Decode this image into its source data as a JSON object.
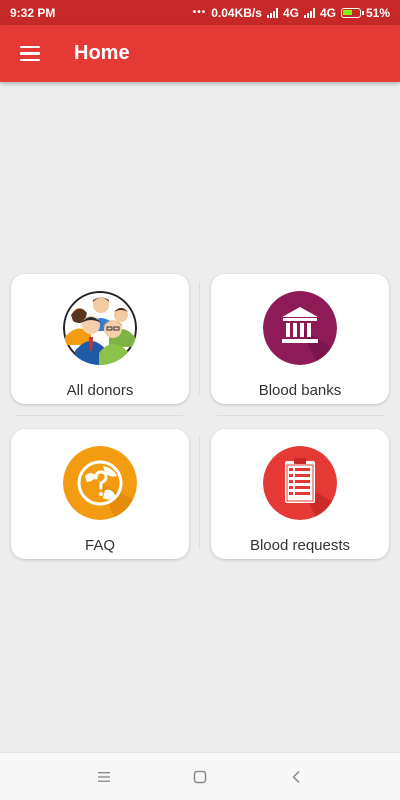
{
  "status_bar": {
    "time": "9:32 PM",
    "dots": "•••",
    "network_speed": "0.04KB/s",
    "network_1": "4G",
    "network_2": "4G",
    "battery": "51%"
  },
  "app_bar": {
    "menu_icon": "hamburger-menu-icon",
    "title": "Home"
  },
  "tiles": [
    {
      "label": "All donors",
      "icon": "donors-group-icon",
      "icon_bg": "#ffffff"
    },
    {
      "label": "Blood banks",
      "icon": "bank-building-icon",
      "icon_bg": "#8e1a57"
    },
    {
      "label": "FAQ",
      "icon": "globe-question-icon",
      "icon_bg": "#f39c12"
    },
    {
      "label": "Blood requests",
      "icon": "clipboard-list-icon",
      "icon_bg": "#e53935"
    }
  ],
  "nav_bar": {
    "recent_icon": "recents-menu-icon",
    "home_icon": "home-square-icon",
    "back_icon": "back-chevron-icon"
  },
  "colors": {
    "status_bar": "#c62828",
    "app_bar": "#e53935",
    "background": "#ededed"
  }
}
